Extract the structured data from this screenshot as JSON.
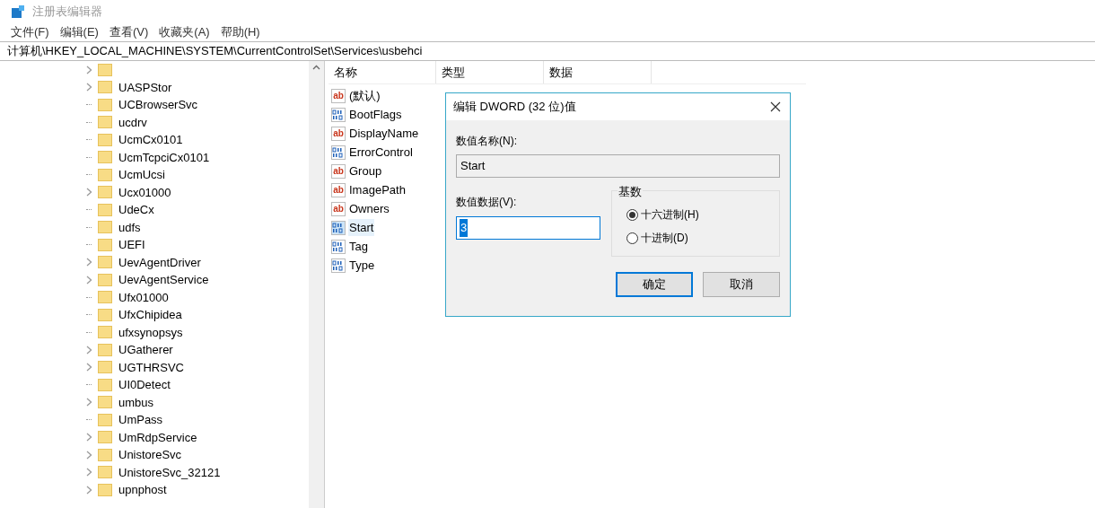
{
  "window": {
    "title": "注册表编辑器"
  },
  "menu": [
    "文件(F)",
    "编辑(E)",
    "查看(V)",
    "收藏夹(A)",
    "帮助(H)"
  ],
  "address": "计算机\\HKEY_LOCAL_MACHINE\\SYSTEM\\CurrentControlSet\\Services\\usbehci",
  "tree": [
    {
      "expandable": true
    },
    {
      "label": "UASPStor",
      "expandable": true
    },
    {
      "label": "UCBrowserSvc",
      "expandable": false
    },
    {
      "label": "ucdrv",
      "expandable": false
    },
    {
      "label": "UcmCx0101",
      "expandable": false
    },
    {
      "label": "UcmTcpciCx0101",
      "expandable": false
    },
    {
      "label": "UcmUcsi",
      "expandable": false
    },
    {
      "label": "Ucx01000",
      "expandable": true
    },
    {
      "label": "UdeCx",
      "expandable": false
    },
    {
      "label": "udfs",
      "expandable": false
    },
    {
      "label": "UEFI",
      "expandable": false
    },
    {
      "label": "UevAgentDriver",
      "expandable": true
    },
    {
      "label": "UevAgentService",
      "expandable": true
    },
    {
      "label": "Ufx01000",
      "expandable": false
    },
    {
      "label": "UfxChipidea",
      "expandable": false
    },
    {
      "label": "ufxsynopsys",
      "expandable": false
    },
    {
      "label": "UGatherer",
      "expandable": true
    },
    {
      "label": "UGTHRSVC",
      "expandable": true
    },
    {
      "label": "UI0Detect",
      "expandable": false
    },
    {
      "label": "umbus",
      "expandable": true
    },
    {
      "label": "UmPass",
      "expandable": false
    },
    {
      "label": "UmRdpService",
      "expandable": true
    },
    {
      "label": "UnistoreSvc",
      "expandable": true
    },
    {
      "label": "UnistoreSvc_32121",
      "expandable": true
    },
    {
      "label": "upnphost",
      "expandable": true
    }
  ],
  "columns": [
    "名称",
    "类型",
    "数据"
  ],
  "values": [
    {
      "name": "(默认)",
      "kind": "string",
      "icon_text": "ab",
      "selected": false
    },
    {
      "name": "BootFlags",
      "kind": "dword",
      "selected": false
    },
    {
      "name": "DisplayName",
      "kind": "string",
      "icon_text": "ab",
      "selected": false
    },
    {
      "name": "ErrorControl",
      "kind": "dword",
      "selected": false
    },
    {
      "name": "Group",
      "kind": "string",
      "icon_text": "ab",
      "selected": false
    },
    {
      "name": "ImagePath",
      "kind": "string",
      "icon_text": "ab",
      "selected": false
    },
    {
      "name": "Owners",
      "kind": "string",
      "icon_text": "ab",
      "selected": false
    },
    {
      "name": "Start",
      "kind": "dword",
      "selected": true
    },
    {
      "name": "Tag",
      "kind": "dword",
      "selected": false
    },
    {
      "name": "Type",
      "kind": "dword",
      "selected": false
    }
  ],
  "dialog": {
    "title": "编辑 DWORD (32 位)值",
    "name_label": "数值名称(N):",
    "name_value": "Start",
    "data_label": "数值数据(V):",
    "data_value": "3",
    "base_label": "基数",
    "bases": [
      {
        "label": "十六进制(H)",
        "selected": true
      },
      {
        "label": "十进制(D)",
        "selected": false
      }
    ],
    "buttons": [
      "确定",
      "取消"
    ]
  }
}
